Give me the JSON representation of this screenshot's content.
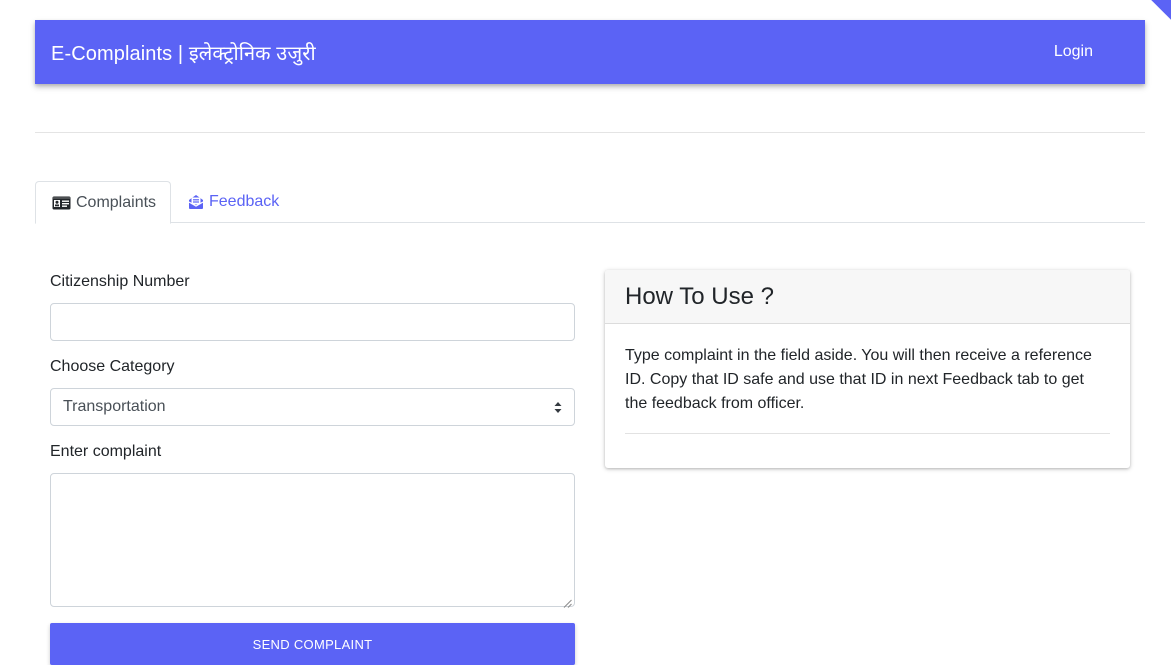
{
  "navbar": {
    "brand": "E-Complaints | इलेक्ट्रोनिक उजुरी",
    "login": "Login"
  },
  "tabs": [
    {
      "label": "Complaints",
      "icon": "id-card-icon",
      "active": true
    },
    {
      "label": "Feedback",
      "icon": "inbox-envelope-icon",
      "active": false
    }
  ],
  "form": {
    "citizenship_label": "Citizenship Number",
    "citizenship_value": "",
    "category_label": "Choose Category",
    "category_selected": "Transportation",
    "complaint_label": "Enter complaint",
    "complaint_value": "",
    "submit_label": "SEND COMPLAINT"
  },
  "help_card": {
    "title": "How To Use ?",
    "body": "Type complaint in the field aside. You will then receive a reference ID. Copy that ID safe and use that ID in next Feedback tab to get the feedback from officer."
  },
  "colors": {
    "primary": "#5b63f5",
    "border": "#ced4da",
    "card_header_bg": "#f7f7f7"
  }
}
